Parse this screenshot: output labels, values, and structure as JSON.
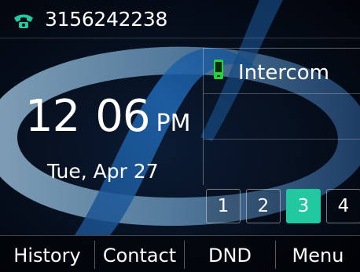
{
  "status_bar": {
    "phone_number": "3156242238",
    "icon": "phone-handset-icon",
    "icon_color": "#22c8a0"
  },
  "clock": {
    "hour": "12",
    "minute": "06",
    "ampm": "PM",
    "date": "Tue, Apr 27"
  },
  "line_keys": [
    {
      "label": "Intercom",
      "icon": "mobile-phone-icon",
      "icon_color": "#23d33a"
    },
    {
      "label": ""
    },
    {
      "label": ""
    }
  ],
  "pages": [
    {
      "label": "1",
      "active": false
    },
    {
      "label": "2",
      "active": false
    },
    {
      "label": "3",
      "active": true
    },
    {
      "label": "4",
      "active": false
    }
  ],
  "softkeys": [
    "History",
    "Contact",
    "DND",
    "Menu"
  ],
  "colors": {
    "accent": "#22c8a0",
    "background": "#02060f"
  }
}
